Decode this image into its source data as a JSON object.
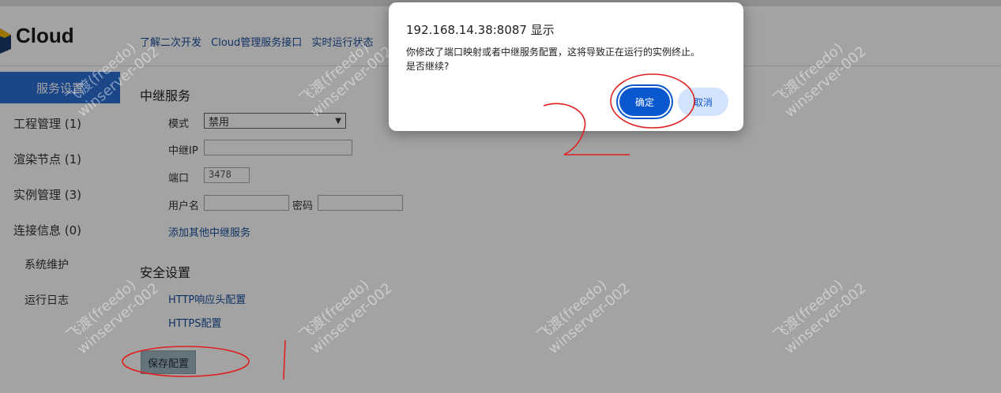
{
  "header": {
    "brand": "Cloud",
    "links": [
      "了解二次开发",
      "Cloud管理服务接口",
      "实时运行状态"
    ]
  },
  "sidebar": {
    "items": [
      {
        "label": "服务设置"
      },
      {
        "label": "工程管理 (1)"
      },
      {
        "label": "渲染节点 (1)"
      },
      {
        "label": "实例管理 (3)"
      },
      {
        "label": "连接信息 (0)"
      },
      {
        "label": "系统维护"
      },
      {
        "label": "运行日志"
      }
    ]
  },
  "relay": {
    "title": "中继服务",
    "mode_label": "模式",
    "mode_value": "禁用",
    "ip_label": "中继IP",
    "ip_value": "",
    "port_label": "端口",
    "port_value": "3478",
    "user_label": "用户名",
    "password_label": "密码",
    "add_link": "添加其他中继服务"
  },
  "security": {
    "title": "安全设置",
    "http_link": "HTTP响应头配置",
    "https_link": "HTTPS配置"
  },
  "save_label": "保存配置",
  "dialog": {
    "title": "192.168.14.38:8087 显示",
    "line1": "你修改了端口映射或者中继服务配置，这将导致正在运行的实例终止。",
    "line2": "是否继续?",
    "ok": "确定",
    "cancel": "取消"
  },
  "watermark": {
    "line1": "飞渡(freedo)",
    "line2": "winserver-002"
  },
  "colors": {
    "accent": "#0b57d0",
    "sidebar_active": "#2b6fd6",
    "annotation": "#e02020"
  }
}
